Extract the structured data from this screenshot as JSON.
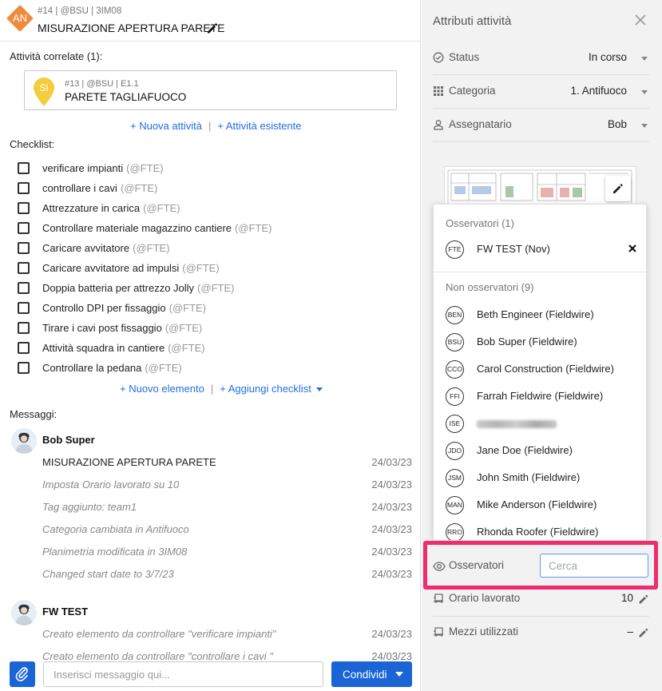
{
  "header": {
    "avatar_initials": "AN",
    "subtitle": "#14 | @BSU | 3IM08",
    "title": "MISURAZIONE APERTURA PARETE"
  },
  "related": {
    "heading": "Attività correlate (1):",
    "card": {
      "initials": "SI",
      "subtitle": "#13 | @BSU | E1.1",
      "title": "PARETE TAGLIAFUOCO"
    },
    "new_link": "+ Nuova attività",
    "separator": "|",
    "existing_link": "+ Attività esistente"
  },
  "checklist": {
    "heading": "Checklist:",
    "items": [
      {
        "text": "verificare impianti",
        "tag": "(@FTE)"
      },
      {
        "text": "controllare i cavi",
        "tag": "(@FTE)"
      },
      {
        "text": "Attrezzature in carica",
        "tag": "(@FTE)"
      },
      {
        "text": "Controllare materiale magazzino cantiere",
        "tag": "(@FTE)"
      },
      {
        "text": "Caricare avvitatore",
        "tag": "(@FTE)"
      },
      {
        "text": "Caricare avvitatore ad impulsi",
        "tag": "(@FTE)"
      },
      {
        "text": "Doppia batteria per attrezzo Jolly",
        "tag": "(@FTE)"
      },
      {
        "text": "Controllo DPI per fissaggio",
        "tag": "(@FTE)"
      },
      {
        "text": "Tirare i cavi post fissaggio",
        "tag": "(@FTE)"
      },
      {
        "text": "Attività squadra in cantiere",
        "tag": "(@FTE)"
      },
      {
        "text": "Controllare la pedana",
        "tag": "(@FTE)"
      }
    ],
    "new_item_link": "+ Nuovo elemento",
    "separator": "|",
    "add_checklist_link": "+ Aggiungi checklist"
  },
  "messages": {
    "heading": "Messaggi:",
    "groups": [
      {
        "author": "Bob Super",
        "entries": [
          {
            "text": "MISURAZIONE APERTURA PARETE",
            "date": "24/03/23"
          },
          {
            "text": "Imposta Orario lavorato su 10",
            "date": "24/03/23"
          },
          {
            "text": "Tag aggiunto: team1",
            "date": "24/03/23"
          },
          {
            "text": "Categoria cambiata in Antifuoco",
            "date": "24/03/23"
          },
          {
            "text": "Planimetria modificata in 3IM08",
            "date": "24/03/23"
          },
          {
            "text": "Changed start date to 3/7/23",
            "date": "24/03/23"
          }
        ]
      },
      {
        "author": "FW TEST",
        "entries": [
          {
            "text": "Creato elemento da controllare \"verificare impianti\"",
            "date": "24/03/23"
          },
          {
            "text": "Creato elemento da controllare \"controllare i cavi \"",
            "date": "24/03/23"
          }
        ]
      }
    ]
  },
  "composer": {
    "placeholder": "Inserisci messaggio qui...",
    "share_label": "Condividi"
  },
  "attributes": {
    "title": "Attributi attività",
    "status": {
      "label": "Status",
      "value": "In corso"
    },
    "category": {
      "label": "Categoria",
      "value": "1. Antifuoco"
    },
    "assignee": {
      "label": "Assegnatario",
      "value": "Bob"
    },
    "observers": {
      "label": "Osservatori",
      "search_placeholder": "Cerca"
    },
    "hours": {
      "label": "Orario lavorato",
      "value": "10"
    },
    "equipment": {
      "label": "Mezzi utilizzati",
      "value": "–"
    }
  },
  "observers_dropdown": {
    "observers_heading": "Osservatori (1)",
    "observers": [
      {
        "initials": "FTE",
        "name": "FW TEST (Nov)"
      }
    ],
    "non_observers_heading": "Non osservatori (9)",
    "non_observers": [
      {
        "initials": "BEN",
        "name": "Beth Engineer (Fieldwire)"
      },
      {
        "initials": "BSU",
        "name": "Bob Super (Fieldwire)"
      },
      {
        "initials": "CCO",
        "name": "Carol Construction (Fieldwire)"
      },
      {
        "initials": "FFI",
        "name": "Farrah Fieldwire (Fieldwire)"
      },
      {
        "initials": "ISE",
        "name": ""
      },
      {
        "initials": "JDO",
        "name": "Jane Doe (Fieldwire)"
      },
      {
        "initials": "JSM",
        "name": "John Smith (Fieldwire)"
      },
      {
        "initials": "MAN",
        "name": "Mike Anderson (Fieldwire)"
      },
      {
        "initials": "RRO",
        "name": "Rhonda Roofer (Fieldwire)"
      }
    ]
  },
  "colors": {
    "accent": "#1a64d6",
    "link": "#1f6fde",
    "highlight": "#ee2c6e",
    "task_orange": "#ee8b3c",
    "task_yellow": "#f4cc3c"
  }
}
